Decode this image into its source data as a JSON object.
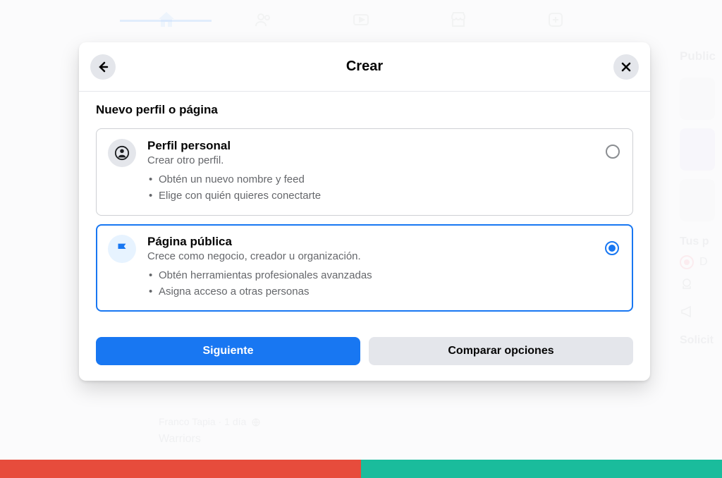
{
  "dialog": {
    "title": "Crear",
    "section_heading": "Nuevo perfil o página"
  },
  "options": {
    "personal": {
      "title": "Perfil personal",
      "subtitle": "Crear otro perfil.",
      "bullets": [
        "Obtén un nuevo nombre y feed",
        "Elige con quién quieres conectarte"
      ],
      "selected": false
    },
    "page": {
      "title": "Página pública",
      "subtitle": "Crece como negocio, creador u organización.",
      "bullets": [
        "Obtén herramientas profesionales avanzadas",
        "Asigna acceso a otras personas"
      ],
      "selected": true
    }
  },
  "buttons": {
    "next": "Siguiente",
    "compare": "Comparar opciones"
  },
  "background": {
    "right_title": "Public",
    "right_pages": "Tus p",
    "right_d": "D",
    "right_solicit": "Solicit",
    "post_author": "Franco Tapia",
    "post_time": "1 día",
    "post_title": "Warriors"
  }
}
